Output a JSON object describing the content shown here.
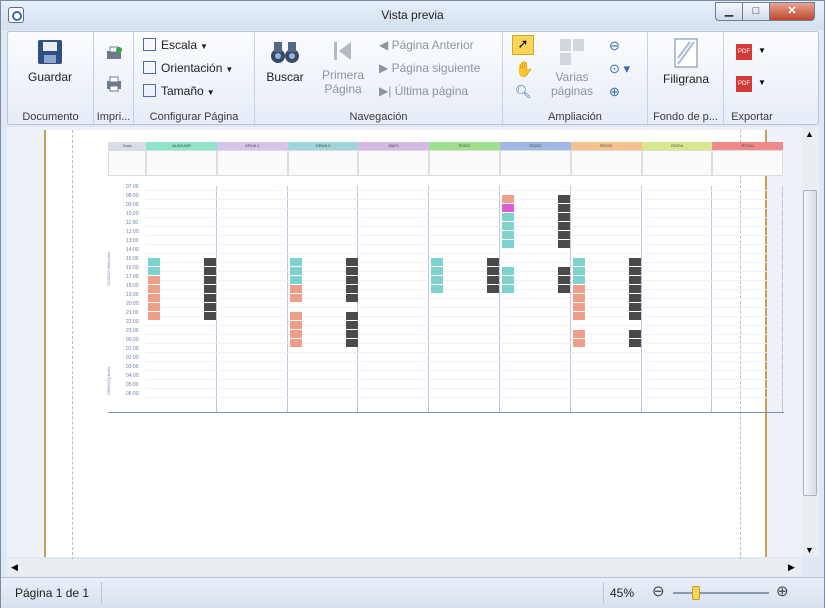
{
  "window": {
    "title": "Vista previa",
    "minimize": "▁",
    "maximize": "□",
    "close": "✕"
  },
  "ribbon": {
    "documento": {
      "save": "Guardar",
      "label": "Documento"
    },
    "imprimir": {
      "label": "Impri..."
    },
    "configurar": {
      "escala": "Escala",
      "orientacion": "Orientación",
      "tamano": "Tamaño",
      "label": "Configurar Página"
    },
    "navegacion": {
      "buscar": "Buscar",
      "primera": "Primera Página",
      "anterior": "Página Anterior",
      "siguiente": "Página siguiente",
      "ultima": "Última página",
      "label": "Navegación"
    },
    "ampliacion": {
      "varias": "Varias páginas",
      "label": "Ampliación"
    },
    "fondo": {
      "filigrana": "Filigrana",
      "label": "Fondo de p..."
    },
    "exportar": {
      "label": "Exportar"
    }
  },
  "status": {
    "page": "Página 1 de 1",
    "zoom": "45%",
    "zoom_fraction": 0.45
  },
  "schedule": {
    "columns": [
      "Grúa",
      "ALAVIJAR",
      "GRUA 1",
      "GRUA 2",
      "MAF1",
      "R2201",
      "R2202",
      "R2203",
      "R2204",
      "RTG11"
    ],
    "hours": [
      "07:00",
      "08:00",
      "09:00",
      "10:00",
      "11:00",
      "12:00",
      "13:00",
      "14:00",
      "15:00",
      "16:00",
      "17:00",
      "18:00",
      "19:00",
      "20:00",
      "21:00",
      "22:00",
      "23:00",
      "00:00",
      "01:00",
      "02:00",
      "03:00",
      "04:00",
      "05:00",
      "06:00"
    ],
    "day1": "22/05/13 miércoles",
    "day2": "23/05/13 jueves"
  },
  "colors": {
    "accent": "#3a6bb0",
    "teal": "#7fd3cf",
    "salmon": "#ef9e8a",
    "dark": "#4a4a4a",
    "magenta": "#e05ad6"
  }
}
